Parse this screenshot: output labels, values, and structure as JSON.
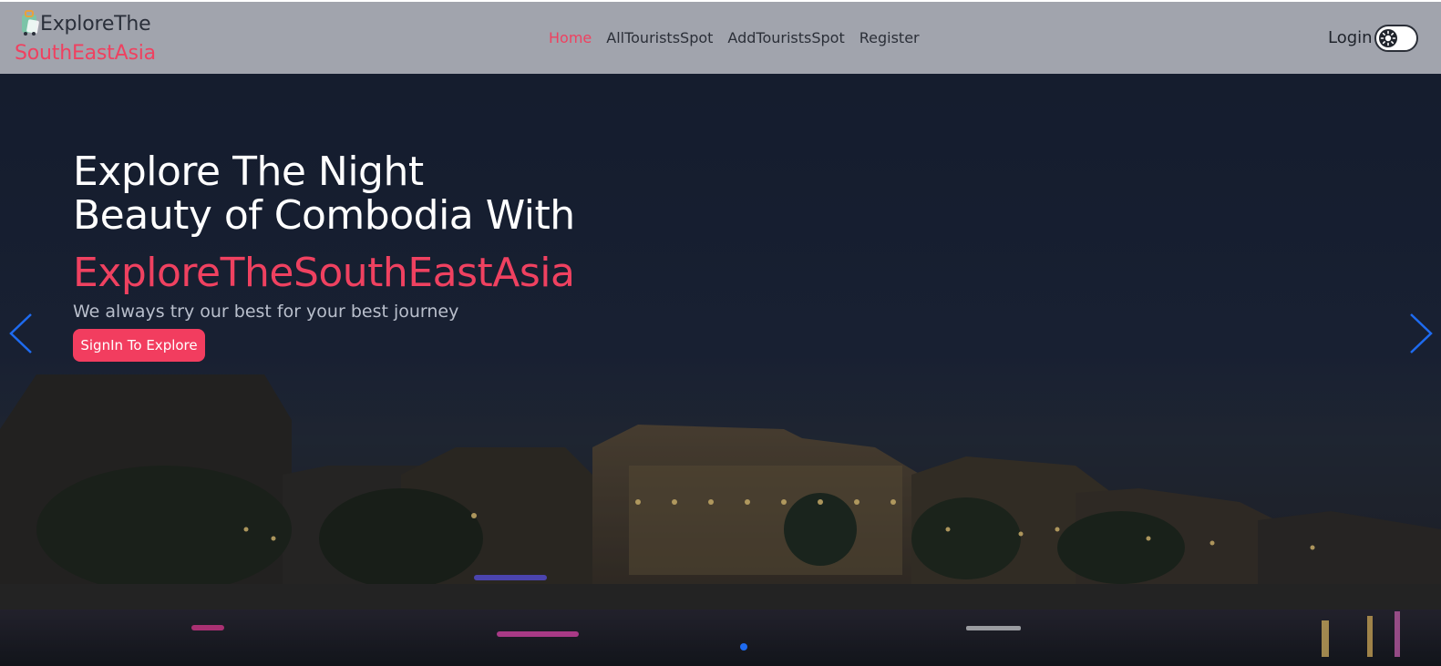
{
  "brand": {
    "line1": "ExploreThe",
    "line2": "SouthEastAsia",
    "logo_icon": "travel-luggage-icon"
  },
  "nav": {
    "items": [
      {
        "label": "Home",
        "active": true
      },
      {
        "label": "AllTouristsSpot",
        "active": false
      },
      {
        "label": "AddTouristsSpot",
        "active": false
      },
      {
        "label": "Register",
        "active": false
      }
    ]
  },
  "header_right": {
    "login_label": "Login",
    "theme_toggle_icon": "sun-icon",
    "theme_toggle_state": "light"
  },
  "hero": {
    "title_line1": "Explore The Night",
    "title_line2": "Beauty of Combodia With",
    "brand_text": "ExploreTheSouthEastAsia",
    "subtitle": "We always try our best for your best journey",
    "cta_label": "SignIn To Explore",
    "prev_icon": "chevron-left-icon",
    "next_icon": "chevron-right-icon",
    "slides_indicator_icon": "carousel-dot-icon"
  },
  "colors": {
    "navbar_bg": "#a1a4ad",
    "accent": "#ef4160",
    "cta_bg": "#f23d5f",
    "arrow": "#1e6bf0",
    "hero_overlay": "#1c2335"
  }
}
